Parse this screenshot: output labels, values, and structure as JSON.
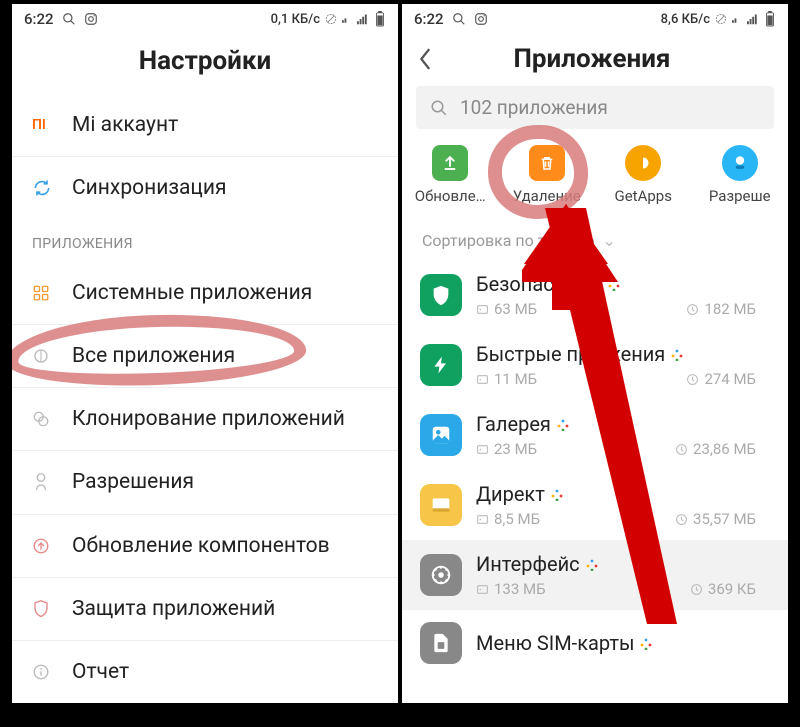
{
  "left": {
    "status": {
      "time": "6:22",
      "net": "0,1 КБ/с"
    },
    "title": "Настройки",
    "items": {
      "mi": "Mi аккаунт",
      "sync": "Синхронизация"
    },
    "section": "ПРИЛОЖЕНИЯ",
    "apps_items": {
      "sys": "Системные приложения",
      "all": "Все приложения",
      "clone": "Клонирование приложений",
      "perm": "Разрешения",
      "update": "Обновление компонентов",
      "protect": "Защита приложений",
      "report": "Отчет"
    }
  },
  "right": {
    "status": {
      "time": "6:22",
      "net": "8,6 КБ/с"
    },
    "title": "Приложения",
    "search": "102 приложения",
    "actions": {
      "update": "Обновле…",
      "uninstall": "Удаление",
      "getapps": "GetApps",
      "perm": "Разреше"
    },
    "sort": "Сортировка по     тоянию",
    "apps": [
      {
        "name": "Безопасно   ть",
        "storage": "63 МБ",
        "data": "182 МБ",
        "color": "#10a060",
        "icon": "shield"
      },
      {
        "name": "Быстрые пр   ожения",
        "storage": "11 МБ",
        "data": "274 МБ",
        "color": "#10a060",
        "icon": "lightning"
      },
      {
        "name": "Галерея",
        "storage": "23 МБ",
        "data": "23,86 МБ",
        "color": "#2aa8e8",
        "icon": "gallery"
      },
      {
        "name": "Директ",
        "storage": "8,5 МБ",
        "data": "35,57 МБ",
        "color": "#f7c648",
        "icon": "direct"
      },
      {
        "name": "Интерфейс",
        "storage": "133 МБ",
        "data": "369 КБ",
        "color": "#888",
        "icon": "interface"
      },
      {
        "name": "Меню SIM-карты",
        "storage": "",
        "data": "",
        "color": "#888",
        "icon": "sim"
      }
    ]
  }
}
